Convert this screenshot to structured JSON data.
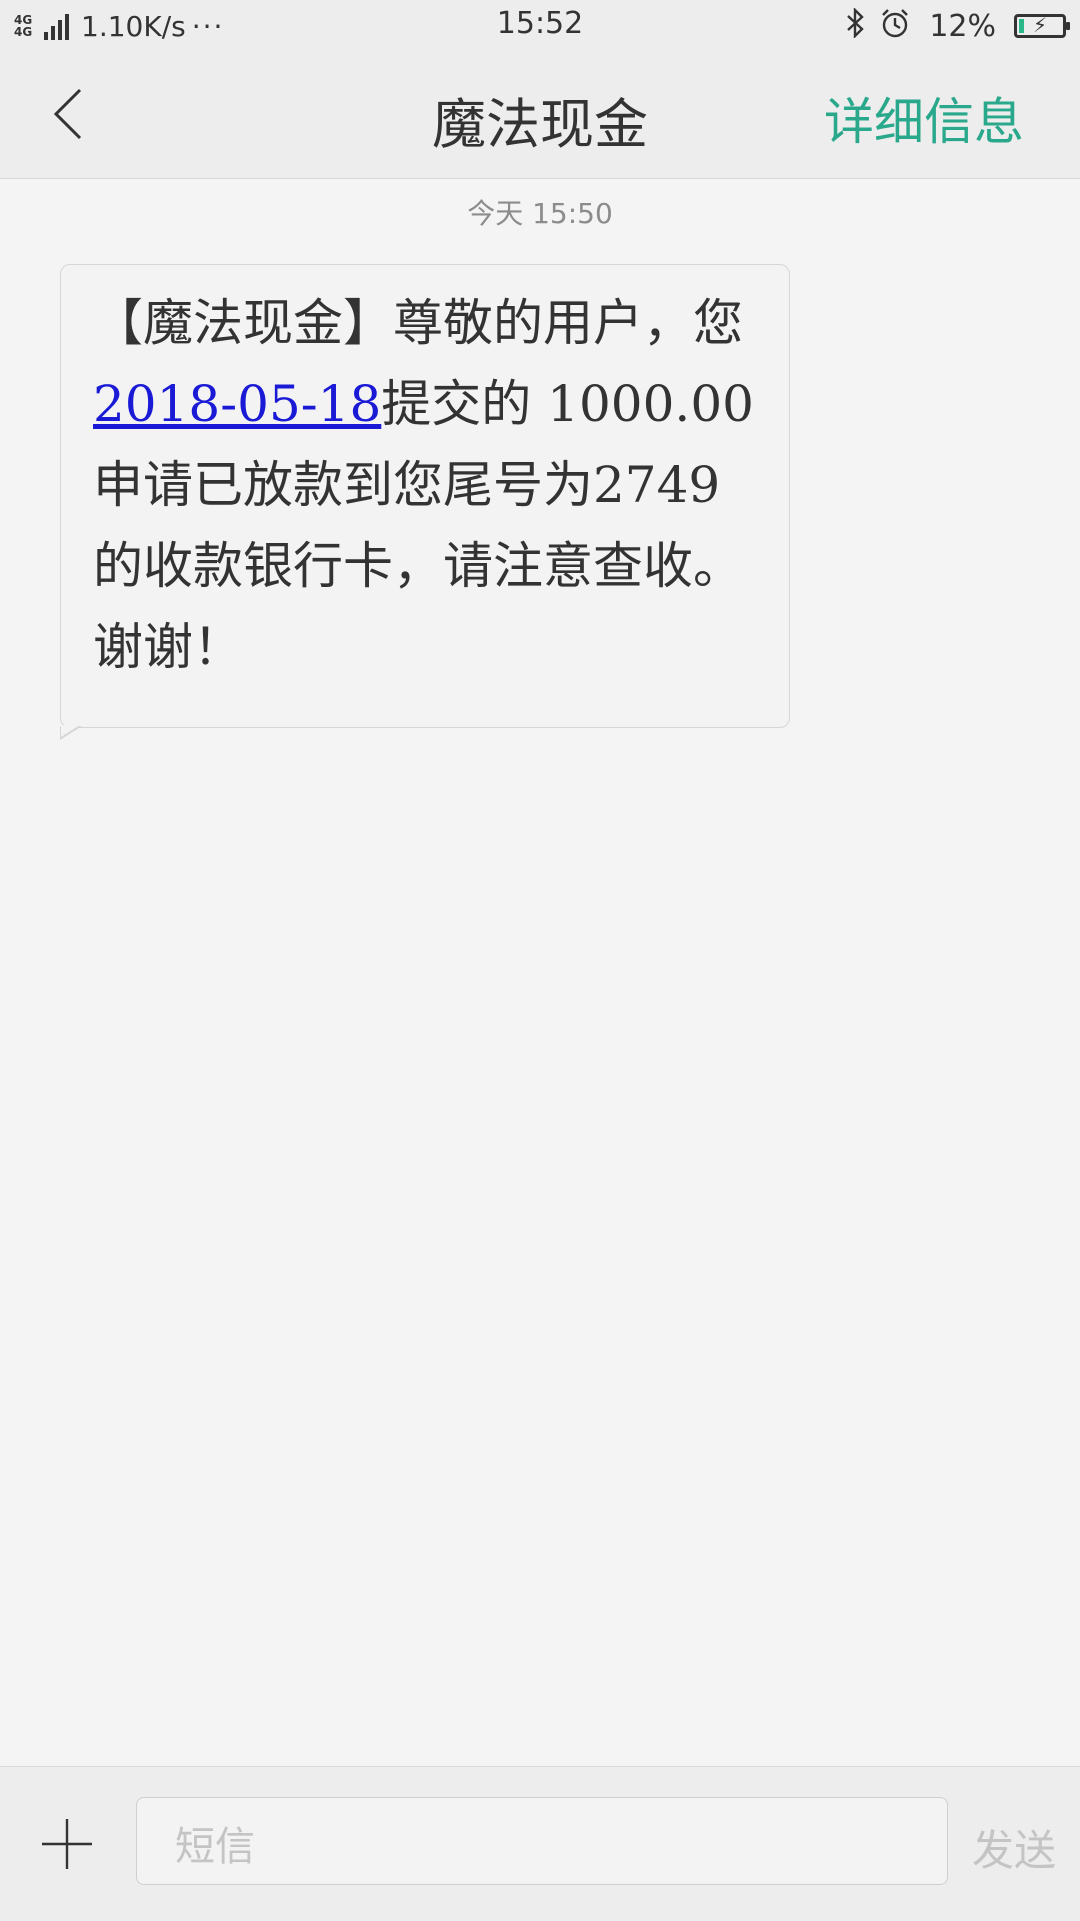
{
  "status_bar": {
    "network": "4G",
    "network_secondary": "4G",
    "speed": "1.10K/s",
    "dots": "···",
    "time": "15:52",
    "battery_percent": "12%",
    "battery_level": 0.12,
    "battery_color": "#2ab88b",
    "icons": [
      "bluetooth-icon",
      "alarm-icon",
      "battery-icon"
    ]
  },
  "header": {
    "title": "魔法现金",
    "detail_label": "详细信息",
    "accent_color": "#2aa88c"
  },
  "conversation": {
    "timestamp": "今天  15:50",
    "messages": [
      {
        "text_before_link": "【魔法现金】尊敬的用户，您",
        "link": "2018-05-18",
        "text_after_link": "提交的 1000.00申请已放款到您尾号为2749的收款银行卡，请注意查收。谢谢！",
        "link_color": "#1a1ad6"
      }
    ]
  },
  "composer": {
    "placeholder": "短信",
    "send_label": "发送"
  }
}
